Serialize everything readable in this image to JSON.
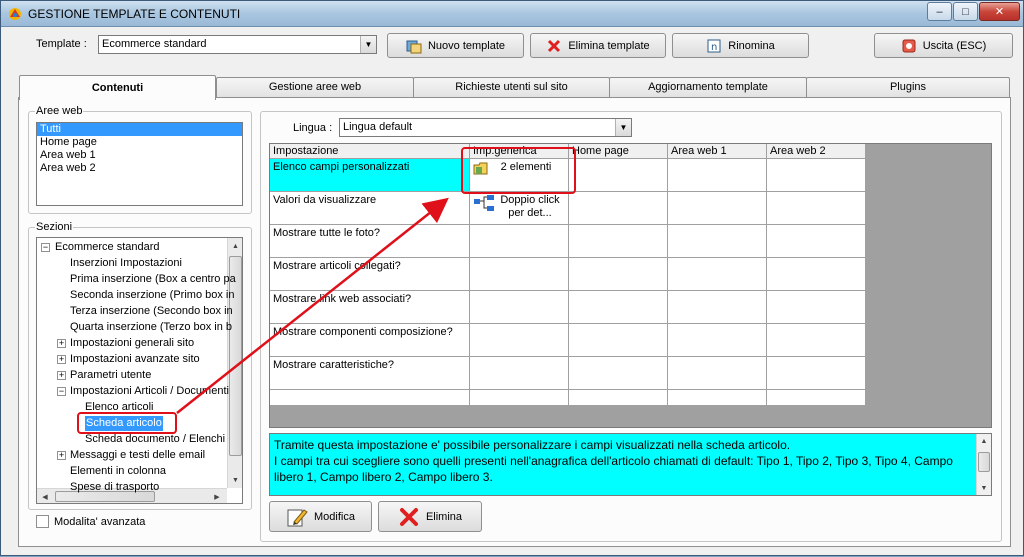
{
  "window": {
    "title": "GESTIONE TEMPLATE E CONTENUTI",
    "minimize": "–",
    "maximize": "□",
    "close": "✕"
  },
  "toolbar": {
    "template_label": "Template :",
    "template_value": "Ecommerce standard",
    "nuovo": "Nuovo template",
    "elimina": "Elimina template",
    "rinomina": "Rinomina",
    "uscita": "Uscita (ESC)"
  },
  "tabs": [
    "Contenuti",
    "Gestione aree web",
    "Richieste utenti sul sito",
    "Aggiornamento template",
    "Plugins"
  ],
  "aree_web": {
    "label": "Aree web",
    "items": [
      "Tutti",
      "Home page",
      "Area web 1",
      "Area web 2"
    ],
    "selected": 0
  },
  "sezioni": {
    "label": "Sezioni",
    "nodes": [
      {
        "text": "Ecommerce standard",
        "level": 0,
        "exp": "−"
      },
      {
        "text": "Inserzioni Impostazioni",
        "level": 1
      },
      {
        "text": "Prima inserzione (Box a centro pa",
        "level": 1
      },
      {
        "text": "Seconda inserzione (Primo box in",
        "level": 1
      },
      {
        "text": "Terza inserzione (Secondo box in",
        "level": 1
      },
      {
        "text": "Quarta inserzione (Terzo box in b",
        "level": 1
      },
      {
        "text": "Impostazioni generali sito",
        "level": 1,
        "exp": "+"
      },
      {
        "text": "Impostazioni avanzate sito",
        "level": 1,
        "exp": "+"
      },
      {
        "text": "Parametri utente",
        "level": 1,
        "exp": "+"
      },
      {
        "text": "Impostazioni Articoli / Documenti",
        "level": 1,
        "exp": "−"
      },
      {
        "text": "Elenco articoli",
        "level": 2
      },
      {
        "text": "Scheda articolo",
        "level": 2,
        "selected": true
      },
      {
        "text": "Scheda documento / Elenchi",
        "level": 2
      },
      {
        "text": "Messaggi e testi delle email",
        "level": 1,
        "exp": "+"
      },
      {
        "text": "Elementi in colonna",
        "level": 1
      },
      {
        "text": "Spese di trasporto",
        "level": 1
      }
    ]
  },
  "modalita": "Modalita' avanzata",
  "lingua": {
    "label": "Lingua :",
    "value": "Lingua default"
  },
  "grid": {
    "headers": [
      "Impostazione",
      "Imp.generica",
      "Home page",
      "Area web 1",
      "Area web 2"
    ],
    "rows": [
      {
        "label": "Elenco campi personalizzati",
        "value": "2 elementi"
      },
      {
        "label": "Valori da visualizzare",
        "value": "Doppio click per det..."
      },
      {
        "label": "Mostrare tutte le foto?",
        "value": ""
      },
      {
        "label": "Mostrare articoli collegati?",
        "value": ""
      },
      {
        "label": "Mostrare link web associati?",
        "value": ""
      },
      {
        "label": "Mostrare componenti composizione?",
        "value": ""
      },
      {
        "label": "Mostrare caratteristiche?",
        "value": ""
      }
    ]
  },
  "description": "Tramite questa impostazione e' possibile personalizzare i campi visualizzati nella scheda articolo.\nI campi tra cui scegliere sono quelli presenti nell'anagrafica dell'articolo chiamati di default: Tipo 1, Tipo 2, Tipo 3, Tipo 4, Campo libero 1, Campo libero 2, Campo libero 3.",
  "buttons": {
    "modifica": "Modifica",
    "elimina": "Elimina"
  },
  "colors": {
    "highlight": "#00ffff",
    "annotation": "#e0101a",
    "selection": "#3399ff"
  }
}
